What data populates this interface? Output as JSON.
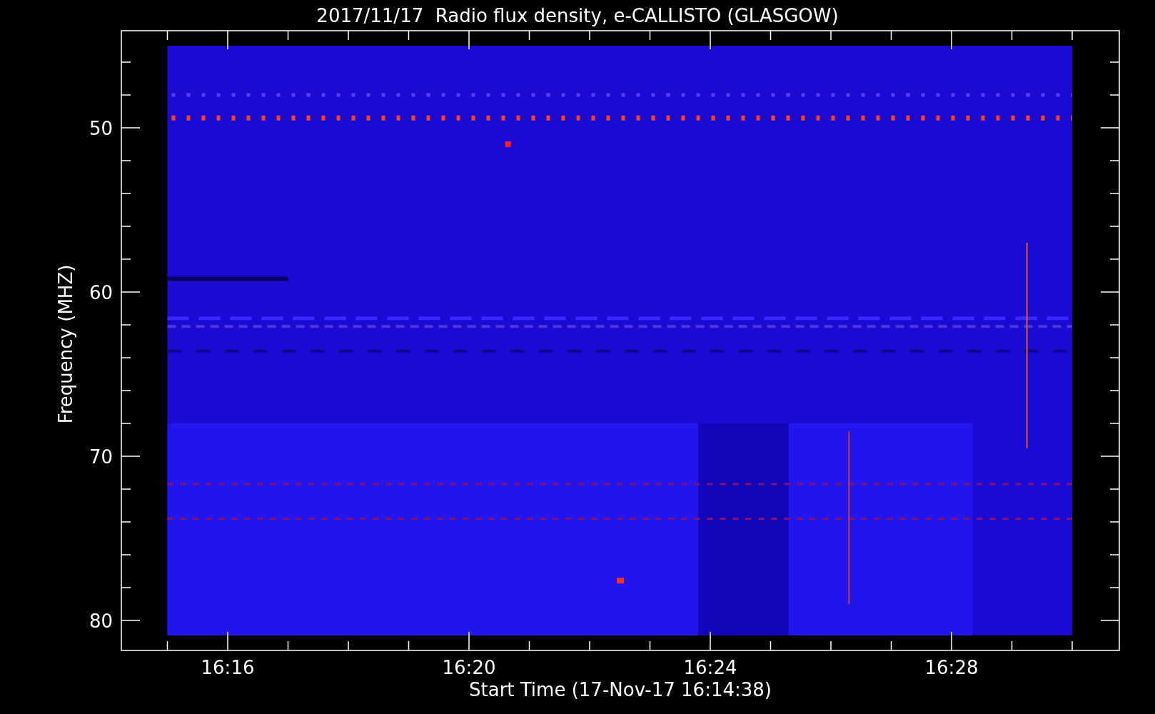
{
  "plot": {
    "title": "2017/11/17  Radio flux density, e-CALLISTO (GLASGOW)",
    "y_axis": {
      "label": "Frequency (MHZ)",
      "ticks": [
        "50",
        "60",
        "70",
        "80"
      ]
    },
    "x_axis": {
      "label": "Start Time (17-Nov-17 16:14:38)",
      "ticks": [
        "16:16",
        "16:20",
        "16:24",
        "16:28"
      ]
    }
  }
}
